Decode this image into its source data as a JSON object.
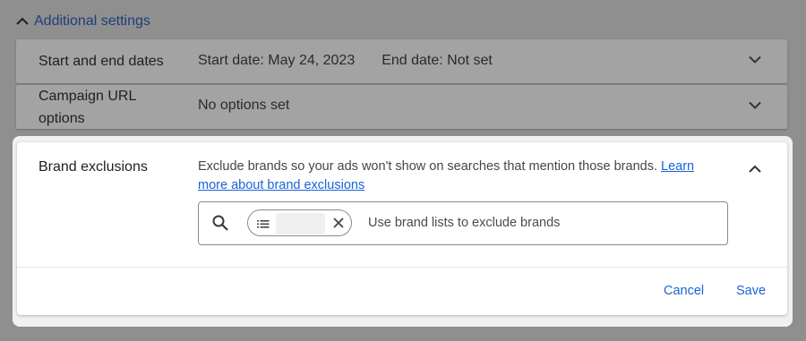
{
  "section": {
    "toggle_label": "Additional settings"
  },
  "rows": {
    "dates": {
      "title": "Start and end dates",
      "start": "Start date: May 24, 2023",
      "end": "End date: Not set"
    },
    "url_options": {
      "title": "Campaign URL options",
      "value": "No options set"
    }
  },
  "brand_exclusions": {
    "title": "Brand exclusions",
    "description": "Exclude brands so your ads won't show on searches that mention those brands.",
    "learn_more": "Learn more about brand exclusions",
    "search_placeholder": "Use brand lists to exclude brands",
    "cancel_label": "Cancel",
    "save_label": "Save"
  },
  "colors": {
    "accent": "#1a62d6",
    "overlay": "#8f8f8f"
  }
}
